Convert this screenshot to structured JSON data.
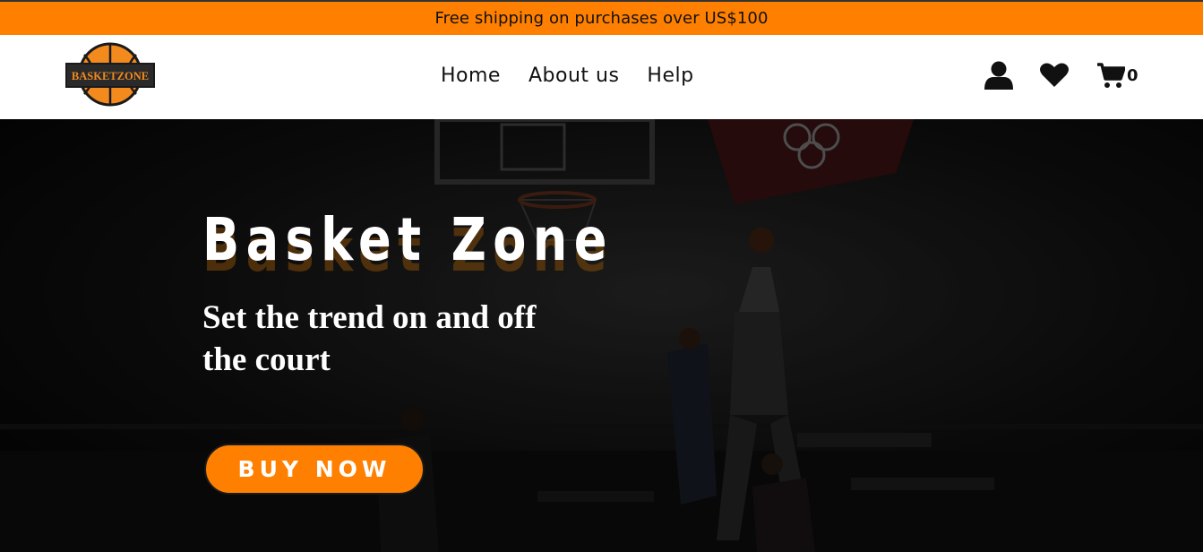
{
  "promo": {
    "text": "Free shipping on purchases over US$100"
  },
  "brand": {
    "logo_text": "BASKETZONE",
    "accent_color": "#ff8000"
  },
  "nav": {
    "links": [
      {
        "label": "Home"
      },
      {
        "label": "About us"
      },
      {
        "label": "Help"
      }
    ],
    "icons": [
      "user-icon",
      "heart-icon",
      "cart-icon"
    ],
    "cart_count": "0"
  },
  "hero": {
    "title": "Basket Zone",
    "subtitle": "Set the trend on and off the court",
    "cta_label": "BUY NOW",
    "background": "dark arena photo of a basketball dunk"
  }
}
